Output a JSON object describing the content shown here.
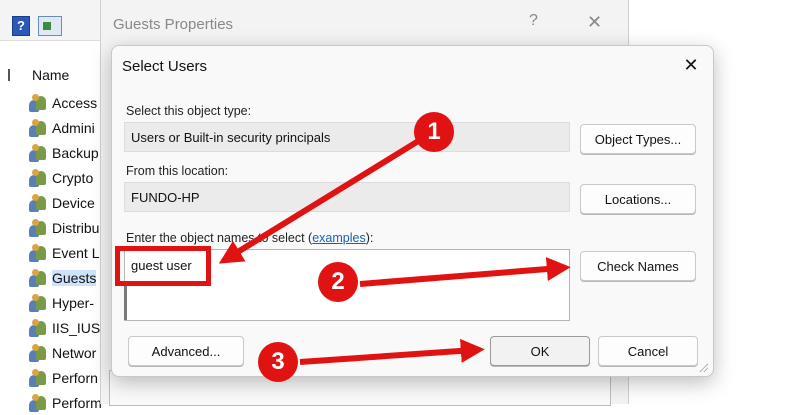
{
  "toolbar": {
    "help_glyph": "?",
    "icons": [
      "help-icon",
      "view-icon"
    ]
  },
  "left_pane": {
    "column_header": "Name",
    "groups": [
      "Access",
      "Admini",
      "Backup",
      "Crypto",
      "Device",
      "Distribu",
      "Event L",
      "Guests",
      "Hyper-",
      "IIS_IUSI",
      "Networ",
      "Perforn",
      "Perform"
    ],
    "selected_index": 7
  },
  "properties_window": {
    "title": "Guests Properties",
    "help_glyph": "?",
    "close_glyph": "✕"
  },
  "dialog": {
    "title": "Select Users",
    "close_glyph": "✕",
    "object_type_label": "Select this object type:",
    "object_type_value": "Users or Built-in security principals",
    "object_types_button": "Object Types...",
    "location_label": "From this location:",
    "location_value": "FUNDO-HP",
    "locations_button": "Locations...",
    "enter_names_label_prefix": "Enter the object names to select (",
    "examples_link": "examples",
    "enter_names_label_suffix": "):",
    "names_value": "guest user",
    "check_names_button": "Check Names",
    "advanced_button": "Advanced...",
    "ok_button": "OK",
    "cancel_button": "Cancel"
  },
  "annotations": {
    "step1": "1",
    "step2": "2",
    "step3": "3",
    "color": "#e01212"
  }
}
